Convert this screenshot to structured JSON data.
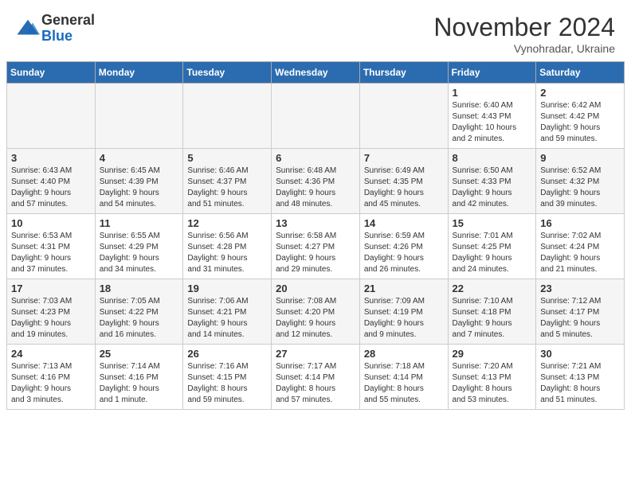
{
  "logo": {
    "general": "General",
    "blue": "Blue"
  },
  "title": "November 2024",
  "location": "Vynohradar, Ukraine",
  "days_header": [
    "Sunday",
    "Monday",
    "Tuesday",
    "Wednesday",
    "Thursday",
    "Friday",
    "Saturday"
  ],
  "weeks": [
    [
      {
        "day": "",
        "info": ""
      },
      {
        "day": "",
        "info": ""
      },
      {
        "day": "",
        "info": ""
      },
      {
        "day": "",
        "info": ""
      },
      {
        "day": "",
        "info": ""
      },
      {
        "day": "1",
        "info": "Sunrise: 6:40 AM\nSunset: 4:43 PM\nDaylight: 10 hours\nand 2 minutes."
      },
      {
        "day": "2",
        "info": "Sunrise: 6:42 AM\nSunset: 4:42 PM\nDaylight: 9 hours\nand 59 minutes."
      }
    ],
    [
      {
        "day": "3",
        "info": "Sunrise: 6:43 AM\nSunset: 4:40 PM\nDaylight: 9 hours\nand 57 minutes."
      },
      {
        "day": "4",
        "info": "Sunrise: 6:45 AM\nSunset: 4:39 PM\nDaylight: 9 hours\nand 54 minutes."
      },
      {
        "day": "5",
        "info": "Sunrise: 6:46 AM\nSunset: 4:37 PM\nDaylight: 9 hours\nand 51 minutes."
      },
      {
        "day": "6",
        "info": "Sunrise: 6:48 AM\nSunset: 4:36 PM\nDaylight: 9 hours\nand 48 minutes."
      },
      {
        "day": "7",
        "info": "Sunrise: 6:49 AM\nSunset: 4:35 PM\nDaylight: 9 hours\nand 45 minutes."
      },
      {
        "day": "8",
        "info": "Sunrise: 6:50 AM\nSunset: 4:33 PM\nDaylight: 9 hours\nand 42 minutes."
      },
      {
        "day": "9",
        "info": "Sunrise: 6:52 AM\nSunset: 4:32 PM\nDaylight: 9 hours\nand 39 minutes."
      }
    ],
    [
      {
        "day": "10",
        "info": "Sunrise: 6:53 AM\nSunset: 4:31 PM\nDaylight: 9 hours\nand 37 minutes."
      },
      {
        "day": "11",
        "info": "Sunrise: 6:55 AM\nSunset: 4:29 PM\nDaylight: 9 hours\nand 34 minutes."
      },
      {
        "day": "12",
        "info": "Sunrise: 6:56 AM\nSunset: 4:28 PM\nDaylight: 9 hours\nand 31 minutes."
      },
      {
        "day": "13",
        "info": "Sunrise: 6:58 AM\nSunset: 4:27 PM\nDaylight: 9 hours\nand 29 minutes."
      },
      {
        "day": "14",
        "info": "Sunrise: 6:59 AM\nSunset: 4:26 PM\nDaylight: 9 hours\nand 26 minutes."
      },
      {
        "day": "15",
        "info": "Sunrise: 7:01 AM\nSunset: 4:25 PM\nDaylight: 9 hours\nand 24 minutes."
      },
      {
        "day": "16",
        "info": "Sunrise: 7:02 AM\nSunset: 4:24 PM\nDaylight: 9 hours\nand 21 minutes."
      }
    ],
    [
      {
        "day": "17",
        "info": "Sunrise: 7:03 AM\nSunset: 4:23 PM\nDaylight: 9 hours\nand 19 minutes."
      },
      {
        "day": "18",
        "info": "Sunrise: 7:05 AM\nSunset: 4:22 PM\nDaylight: 9 hours\nand 16 minutes."
      },
      {
        "day": "19",
        "info": "Sunrise: 7:06 AM\nSunset: 4:21 PM\nDaylight: 9 hours\nand 14 minutes."
      },
      {
        "day": "20",
        "info": "Sunrise: 7:08 AM\nSunset: 4:20 PM\nDaylight: 9 hours\nand 12 minutes."
      },
      {
        "day": "21",
        "info": "Sunrise: 7:09 AM\nSunset: 4:19 PM\nDaylight: 9 hours\nand 9 minutes."
      },
      {
        "day": "22",
        "info": "Sunrise: 7:10 AM\nSunset: 4:18 PM\nDaylight: 9 hours\nand 7 minutes."
      },
      {
        "day": "23",
        "info": "Sunrise: 7:12 AM\nSunset: 4:17 PM\nDaylight: 9 hours\nand 5 minutes."
      }
    ],
    [
      {
        "day": "24",
        "info": "Sunrise: 7:13 AM\nSunset: 4:16 PM\nDaylight: 9 hours\nand 3 minutes."
      },
      {
        "day": "25",
        "info": "Sunrise: 7:14 AM\nSunset: 4:16 PM\nDaylight: 9 hours\nand 1 minute."
      },
      {
        "day": "26",
        "info": "Sunrise: 7:16 AM\nSunset: 4:15 PM\nDaylight: 8 hours\nand 59 minutes."
      },
      {
        "day": "27",
        "info": "Sunrise: 7:17 AM\nSunset: 4:14 PM\nDaylight: 8 hours\nand 57 minutes."
      },
      {
        "day": "28",
        "info": "Sunrise: 7:18 AM\nSunset: 4:14 PM\nDaylight: 8 hours\nand 55 minutes."
      },
      {
        "day": "29",
        "info": "Sunrise: 7:20 AM\nSunset: 4:13 PM\nDaylight: 8 hours\nand 53 minutes."
      },
      {
        "day": "30",
        "info": "Sunrise: 7:21 AM\nSunset: 4:13 PM\nDaylight: 8 hours\nand 51 minutes."
      }
    ]
  ]
}
